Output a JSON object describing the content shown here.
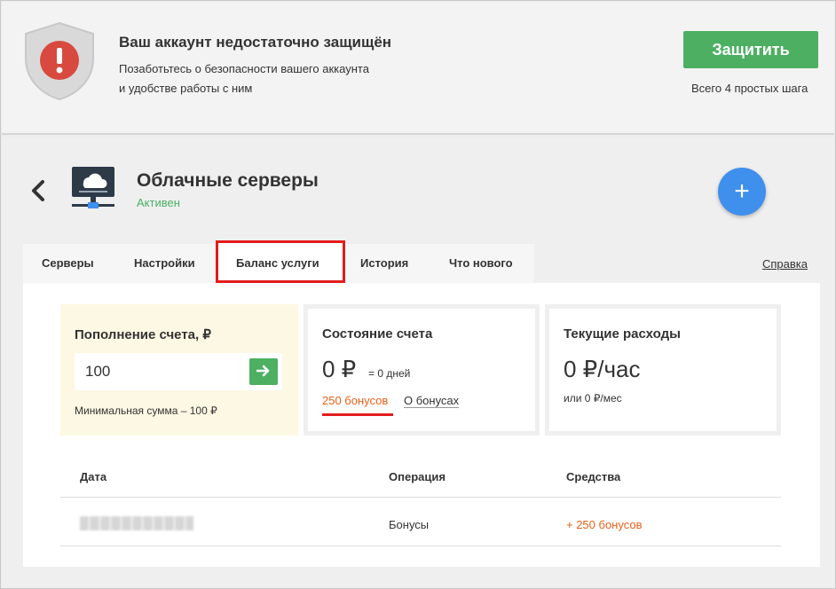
{
  "alert": {
    "title": "Ваш аккаунт недостаточно защищён",
    "line1": "Позаботьтесь о безопасности вашего аккаунта",
    "line2": "и удобстве работы с ним",
    "button_label": "Защитить",
    "hint": "Всего 4 простых шага",
    "icon": "shield-exclamation-icon"
  },
  "service": {
    "title": "Облачные серверы",
    "status": "Активен",
    "add_label": "+"
  },
  "tabs": [
    {
      "label": "Серверы",
      "active": false
    },
    {
      "label": "Настройки",
      "active": false
    },
    {
      "label": "Баланс услуги",
      "active": true
    },
    {
      "label": "История",
      "active": false
    },
    {
      "label": "Что нового",
      "active": false
    }
  ],
  "help_link": "Справка",
  "topup": {
    "title": "Пополнение счета, ₽",
    "amount_value": "100",
    "min_note": "Минимальная сумма – 100 ₽"
  },
  "state": {
    "title": "Состояние счета",
    "amount": "0 ₽",
    "days": "= 0 дней",
    "bonus_link": "250 бонусов",
    "about_bonus": "О бонусах"
  },
  "costs": {
    "title": "Текущие расходы",
    "amount": "0 ₽/час",
    "monthly": "или 0 ₽/мес"
  },
  "table": {
    "headers": [
      "Дата",
      "Операция",
      "Средства"
    ],
    "rows": [
      {
        "date": "",
        "operation": "Бонусы",
        "amount": "+ 250 бонусов"
      }
    ]
  },
  "colors": {
    "accent_green": "#4caf62",
    "accent_blue": "#3f8fec",
    "highlight_red": "#e31c1c",
    "bonus_orange": "#e8611a"
  }
}
